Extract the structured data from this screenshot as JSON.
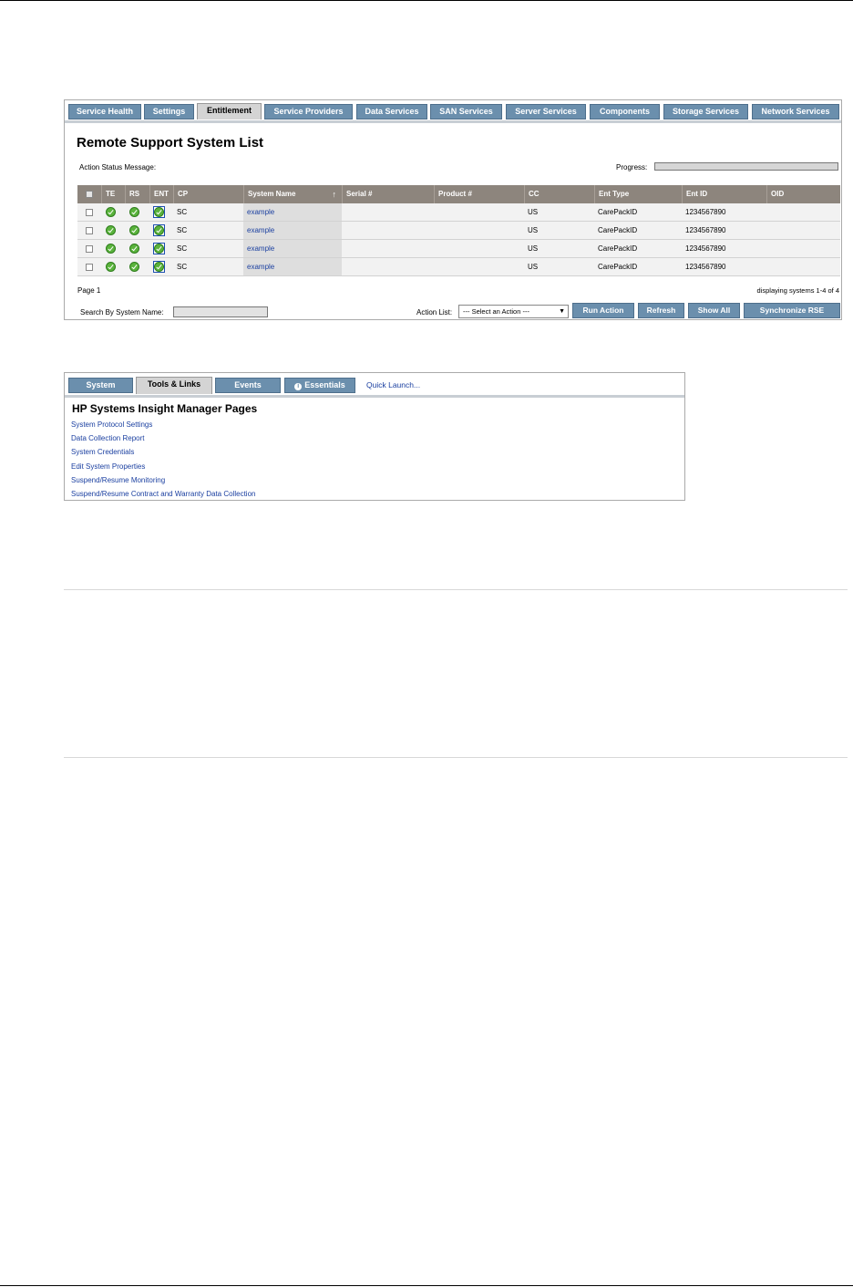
{
  "panel1": {
    "tabs": [
      {
        "label": "Service Health",
        "active": false
      },
      {
        "label": "Settings",
        "active": false
      },
      {
        "label": "Entitlement",
        "active": true
      },
      {
        "label": "Service Providers",
        "active": false
      },
      {
        "label": "Data Services",
        "active": false
      },
      {
        "label": "SAN Services",
        "active": false
      },
      {
        "label": "Server Services",
        "active": false
      },
      {
        "label": "Components",
        "active": false
      },
      {
        "label": "Storage Services",
        "active": false
      },
      {
        "label": "Network Services",
        "active": false
      }
    ],
    "title": "Remote Support System List",
    "status_label": "Action Status Message:",
    "progress_label": "Progress:",
    "progress_value": 0,
    "columns": [
      "TE",
      "RS",
      "ENT",
      "CP",
      "System Name",
      "Serial #",
      "Product #",
      "CC",
      "Ent Type",
      "Ent ID",
      "OID"
    ],
    "sort_icon": "sort-ascending-icon",
    "sort_glyph": "↑",
    "rows": [
      {
        "te": "ok",
        "rs": "ok",
        "ent": "ok",
        "cp": "SC",
        "system_name": "example",
        "serial": "",
        "product": "",
        "cc": "US",
        "ent_type": "CarePackID",
        "ent_id": "1234567890",
        "oid": ""
      },
      {
        "te": "ok",
        "rs": "ok",
        "ent": "ok",
        "cp": "SC",
        "system_name": "example",
        "serial": "",
        "product": "",
        "cc": "US",
        "ent_type": "CarePackID",
        "ent_id": "1234567890",
        "oid": ""
      },
      {
        "te": "ok",
        "rs": "ok",
        "ent": "ok",
        "cp": "SC",
        "system_name": "example",
        "serial": "",
        "product": "",
        "cc": "US",
        "ent_type": "CarePackID",
        "ent_id": "1234567890",
        "oid": ""
      },
      {
        "te": "ok",
        "rs": "ok",
        "ent": "ok",
        "cp": "SC",
        "system_name": "example",
        "serial": "",
        "product": "",
        "cc": "US",
        "ent_type": "CarePackID",
        "ent_id": "1234567890",
        "oid": ""
      }
    ],
    "page_label": "Page 1",
    "display_label": "displaying systems 1-4 of 4",
    "search_label": "Search By System Name:",
    "search_value": "",
    "action_label": "Action List:",
    "action_selected": "--- Select an Action ---",
    "buttons": {
      "run": "Run Action",
      "refresh": "Refresh",
      "show_all": "Show All",
      "sync": "Synchronize RSE"
    },
    "colors": {
      "tab": "#6b8fad",
      "header": "#8d857d",
      "ok": "#5ab33c",
      "link": "#1a3fa0"
    }
  },
  "panel2": {
    "tabs": [
      {
        "label": "System",
        "active": false
      },
      {
        "label": "Tools & Links",
        "active": true
      },
      {
        "label": "Events",
        "active": false
      },
      {
        "label": "Essentials",
        "active": false,
        "icon": "info-icon"
      }
    ],
    "quick_launch": "Quick Launch...",
    "title": "HP Systems Insight Manager Pages",
    "links": [
      "System Protocol Settings",
      "Data Collection Report",
      "System Credentials",
      "Edit System Properties",
      "Suspend/Resume Monitoring",
      "Suspend/Resume Contract and Warranty Data Collection"
    ]
  }
}
